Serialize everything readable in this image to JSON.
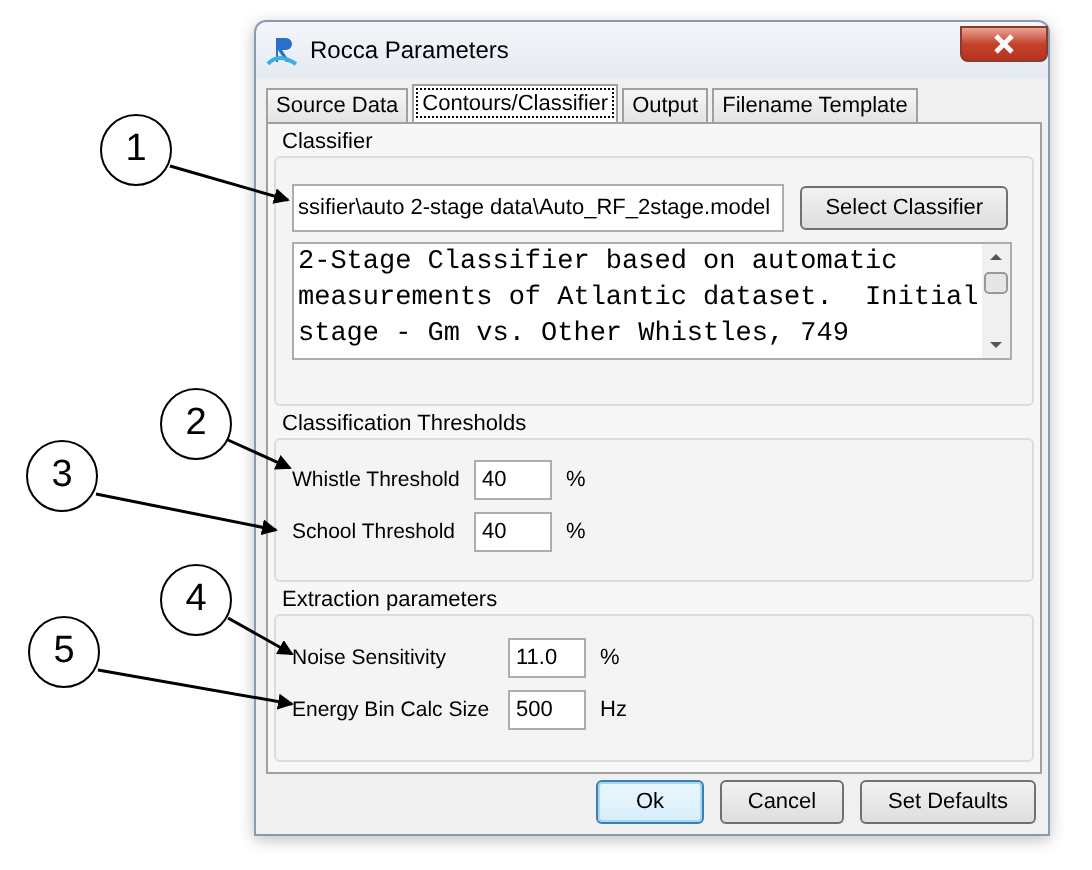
{
  "callouts": [
    {
      "number": "1"
    },
    {
      "number": "2"
    },
    {
      "number": "3"
    },
    {
      "number": "4"
    },
    {
      "number": "5"
    }
  ],
  "window": {
    "title": "Rocca Parameters"
  },
  "tabs": [
    {
      "label": "Source Data",
      "selected": false
    },
    {
      "label": "Contours/Classifier",
      "selected": true
    },
    {
      "label": "Output",
      "selected": false
    },
    {
      "label": "Filename Template",
      "selected": false
    }
  ],
  "classifier": {
    "heading": "Classifier",
    "path": "ssifier\\auto 2-stage data\\Auto_RF_2stage.model",
    "button": "Select Classifier",
    "description_lines": [
      "2-Stage Classifier based on automatic",
      "measurements of Atlantic dataset.  Initial",
      "stage - Gm vs. Other Whistles, 749"
    ]
  },
  "sections": [
    {
      "heading": "Classification Thresholds",
      "rows": [
        {
          "label": "Whistle Threshold",
          "value": "40",
          "unit": "%"
        },
        {
          "label": "School Threshold",
          "value": "40",
          "unit": "%"
        }
      ]
    },
    {
      "heading": "Extraction parameters",
      "rows": [
        {
          "label": "Noise Sensitivity",
          "value": "11.0",
          "unit": "%"
        },
        {
          "label": "Energy Bin Calc Size",
          "value": "500",
          "unit": "Hz"
        }
      ]
    }
  ],
  "buttons": [
    {
      "label": "Ok",
      "default": true
    },
    {
      "label": "Cancel",
      "default": false
    },
    {
      "label": "Set Defaults",
      "default": false
    }
  ]
}
